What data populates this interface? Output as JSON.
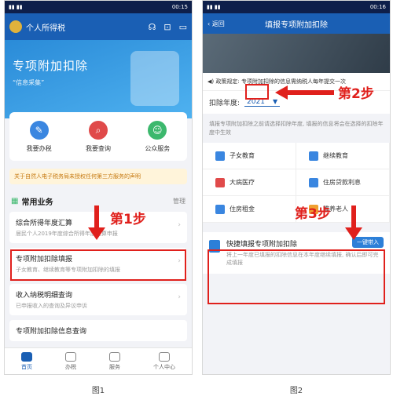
{
  "phone1": {
    "status_time": "00:15",
    "app_title": "个人所得税",
    "banner_title": "专项附加扣除",
    "banner_sub": "“信息采集”",
    "quick": [
      {
        "label": "我要办税",
        "color": "#3a86e0"
      },
      {
        "label": "我要查询",
        "color": "#e04a4a"
      },
      {
        "label": "公众服务",
        "color": "#3cb86d"
      }
    ],
    "notice": "关于自然人电子税务局未授权任何第三方服务的声明",
    "section_title": "常用业务",
    "section_more": "管理",
    "rows": [
      {
        "title": "综合所得年度汇算",
        "desc": "居民个人2019年度综合所得年度汇算申报"
      },
      {
        "title": "专项附加扣除填报",
        "desc": "子女教育、继续教育等专项附加扣除的填报"
      },
      {
        "title": "收入纳税明细查询",
        "desc": "已申报收入的查询及异议申诉"
      },
      {
        "title": "专项附加扣除信息查询",
        "desc": ""
      }
    ],
    "tabs": [
      "首页",
      "办税",
      "服务",
      "个人中心"
    ],
    "step_label": "第1步",
    "caption": "图1"
  },
  "phone2": {
    "status_time": "00:16",
    "back_label": "返回",
    "title": "填报专项附加扣除",
    "policy": "政策规定: 专项附加扣除的信息需纳税人每年提交一次",
    "year_label": "扣除年度:",
    "year_value": "2021",
    "hint": "填报专项附加扣除之前请选择扣除年度, 填报的信息将会在选择的扣除年度中生效",
    "items": [
      {
        "label": "子女教育",
        "color": "#3a86e0"
      },
      {
        "label": "继续教育",
        "color": "#3a86e0"
      },
      {
        "label": "大病医疗",
        "color": "#e04a4a"
      },
      {
        "label": "住房贷款利息",
        "color": "#3a86e0"
      },
      {
        "label": "住房租金",
        "color": "#3a86e0"
      },
      {
        "label": "赡养老人",
        "color": "#f0a030"
      }
    ],
    "fast_title": "快捷填报专项附加扣除",
    "fast_button": "一键带入",
    "fast_desc": "将上一年度已填报的扣除信息在本年度继续填报, 确认后即可完成填报",
    "step2": "第2步",
    "step3": "第3步",
    "caption": "图2"
  }
}
